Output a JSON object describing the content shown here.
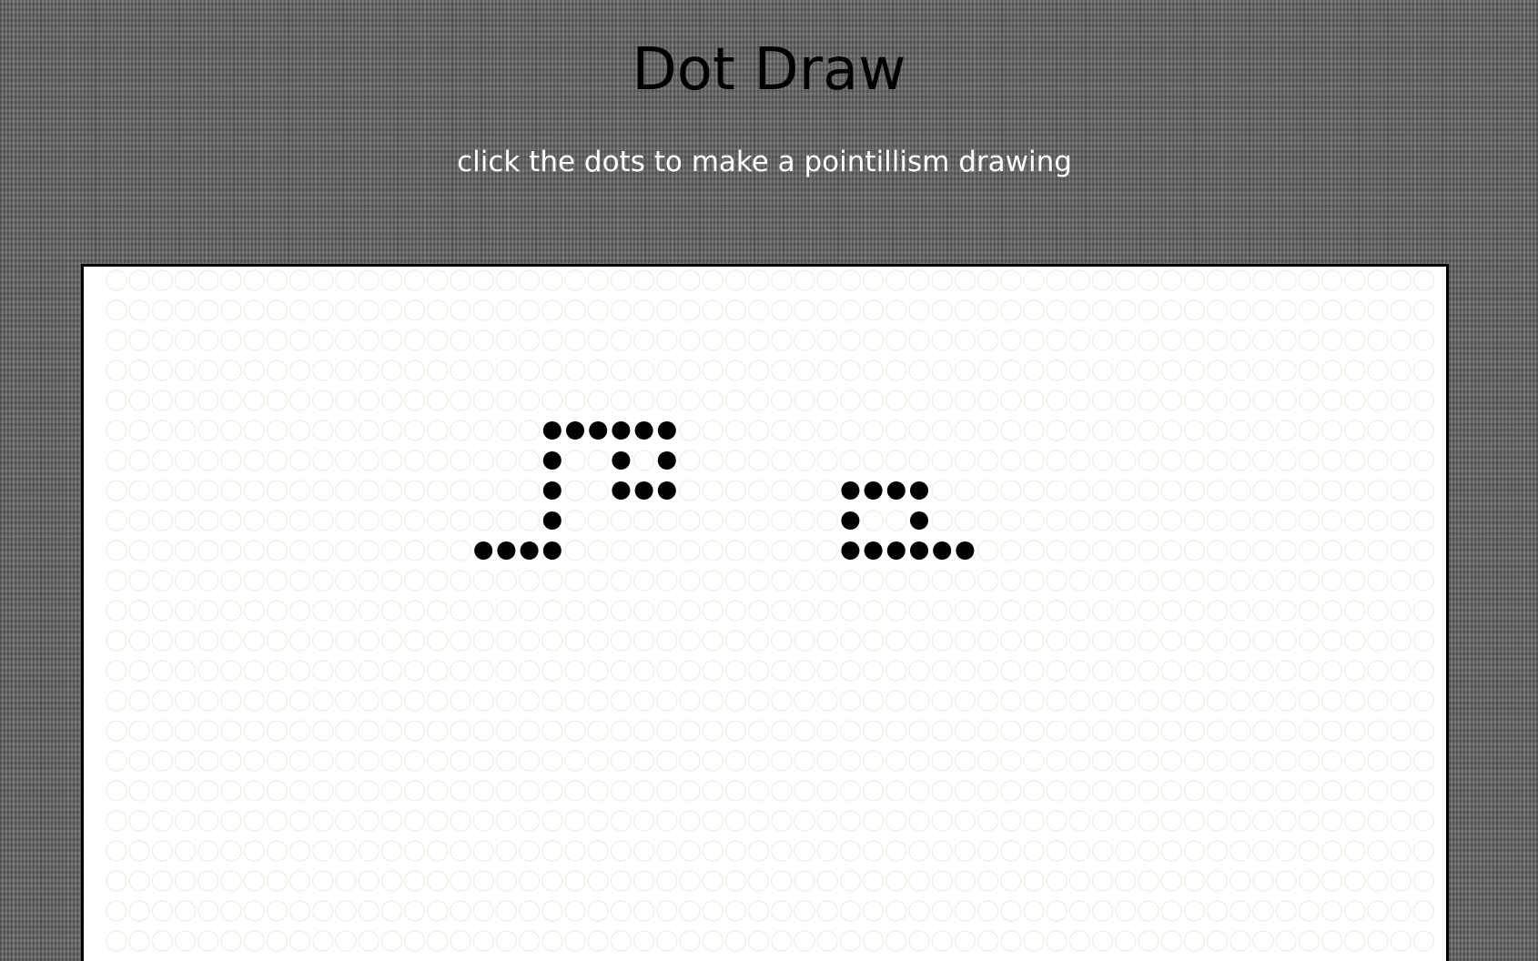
{
  "header": {
    "title": "Dot Draw",
    "subtitle": "click the dots to make a pointillism drawing"
  },
  "colors": {
    "background": "#6e6e6e",
    "board": "#ffffff",
    "dot_empty_stroke": "#eeeee6",
    "dot_filled": "#000000"
  },
  "board": {
    "filled_dots": [
      {
        "row": 5,
        "col": 19
      },
      {
        "row": 5,
        "col": 20
      },
      {
        "row": 5,
        "col": 21
      },
      {
        "row": 5,
        "col": 22
      },
      {
        "row": 5,
        "col": 23
      },
      {
        "row": 5,
        "col": 24
      },
      {
        "row": 6,
        "col": 19
      },
      {
        "row": 6,
        "col": 22
      },
      {
        "row": 6,
        "col": 24
      },
      {
        "row": 7,
        "col": 19
      },
      {
        "row": 7,
        "col": 22
      },
      {
        "row": 7,
        "col": 23
      },
      {
        "row": 7,
        "col": 24
      },
      {
        "row": 7,
        "col": 32
      },
      {
        "row": 7,
        "col": 33
      },
      {
        "row": 7,
        "col": 34
      },
      {
        "row": 7,
        "col": 35
      },
      {
        "row": 8,
        "col": 19
      },
      {
        "row": 8,
        "col": 32
      },
      {
        "row": 8,
        "col": 35
      },
      {
        "row": 9,
        "col": 16
      },
      {
        "row": 9,
        "col": 17
      },
      {
        "row": 9,
        "col": 18
      },
      {
        "row": 9,
        "col": 19
      },
      {
        "row": 9,
        "col": 32
      },
      {
        "row": 9,
        "col": 33
      },
      {
        "row": 9,
        "col": 34
      },
      {
        "row": 9,
        "col": 35
      },
      {
        "row": 9,
        "col": 36
      },
      {
        "row": 9,
        "col": 37
      }
    ]
  }
}
